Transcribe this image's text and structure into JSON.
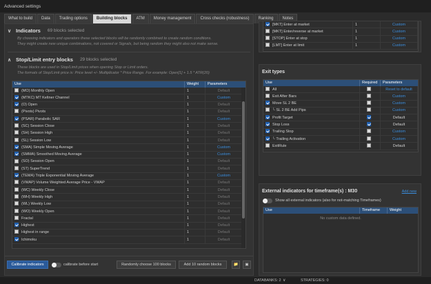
{
  "window": {
    "title": "Advanced settings"
  },
  "tabs": [
    {
      "label": "What to build"
    },
    {
      "label": "Data"
    },
    {
      "label": "Trading options"
    },
    {
      "label": "Building blocks",
      "active": true
    },
    {
      "label": "ATM"
    },
    {
      "label": "Money management"
    },
    {
      "label": "Cross checks (robustness)"
    },
    {
      "label": "Ranking"
    },
    {
      "label": "Notes"
    }
  ],
  "indicators": {
    "title": "Indicators",
    "count": "69 blocks selected",
    "desc1": "By choosing indicators and operators these selected blocks will be randomly combined to create random conditions.",
    "desc2": "They might create new unique combinations, not covered or Signals, but being random they might also not make sense."
  },
  "stoplimit": {
    "title": "Stop/Limit entry blocks",
    "count": "29 blocks selected",
    "desc1": "These blocks are used in Stop/Limit prices when opening Stop or Limit orders.",
    "desc2": "The formats of Stop/Limit price is: Price level +/- Multiplicator * Price Range. For example: Open[1] + 1.5 * ATR(20)",
    "headers": {
      "use": "Use",
      "weight": "Weight",
      "params": "Parameters"
    },
    "rows": [
      {
        "name": "(MO) Monthly Open",
        "on": false,
        "weight": "1",
        "params": "Default"
      },
      {
        "name": "(MTKC) MT Keltner Channel",
        "on": true,
        "weight": "1",
        "params": "Custom"
      },
      {
        "name": "(O) Open",
        "on": true,
        "weight": "1",
        "params": "Default"
      },
      {
        "name": "(Pivots) Pivots",
        "on": false,
        "weight": "1",
        "params": "Default"
      },
      {
        "name": "(PSAR) Parabolic SAR",
        "on": true,
        "weight": "1",
        "params": "Custom"
      },
      {
        "name": "(SC) Session Close",
        "on": false,
        "weight": "1",
        "params": "Default"
      },
      {
        "name": "(SH) Session High",
        "on": false,
        "weight": "1",
        "params": "Default"
      },
      {
        "name": "(SL) Session Low",
        "on": false,
        "weight": "1",
        "params": "Default"
      },
      {
        "name": "(SMA) Simple Moving Average",
        "on": true,
        "weight": "1",
        "params": "Custom"
      },
      {
        "name": "(SMMA) Smoothed Moving Average",
        "on": true,
        "weight": "1",
        "params": "Custom"
      },
      {
        "name": "(SO) Session Open",
        "on": false,
        "weight": "1",
        "params": "Default"
      },
      {
        "name": "(ST) SuperTrend",
        "on": false,
        "weight": "1",
        "params": "Default"
      },
      {
        "name": "(TEMA) Triple Exponential Moving Average",
        "on": true,
        "weight": "1",
        "params": "Custom"
      },
      {
        "name": "(VWAP) Volume Weighted Average Price - VWAP",
        "on": false,
        "weight": "1",
        "params": "Default"
      },
      {
        "name": "(WC) Weekly Close",
        "on": false,
        "weight": "1",
        "params": "Default"
      },
      {
        "name": "(WH) Weekly High",
        "on": false,
        "weight": "1",
        "params": "Default"
      },
      {
        "name": "(WL) Weekly Low",
        "on": false,
        "weight": "1",
        "params": "Default"
      },
      {
        "name": "(WO) Weekly Open",
        "on": false,
        "weight": "1",
        "params": "Default"
      },
      {
        "name": "Fractal",
        "on": false,
        "weight": "1",
        "params": "Default"
      },
      {
        "name": "Highest",
        "on": true,
        "weight": "1",
        "params": "Default"
      },
      {
        "name": "Highest in range",
        "on": false,
        "weight": "1",
        "params": "Default"
      },
      {
        "name": "Ichimoku",
        "on": true,
        "weight": "1",
        "params": "Default"
      }
    ]
  },
  "bottom": {
    "calibrate": "Calibrate indicators",
    "calibrate_toggle": "calibrate before start",
    "random100": "Randomly choose 100 blocks",
    "add10": "Add 10 random blocks"
  },
  "orders": {
    "rows": [
      {
        "name": "[MKT] Enter at market",
        "on": true,
        "weight": "1",
        "params": "Custom"
      },
      {
        "name": "[MKT] Enter/reverse at market",
        "on": false,
        "weight": "1",
        "params": "Custom"
      },
      {
        "name": "[STOP] Enter at stop",
        "on": false,
        "weight": "1",
        "params": "Custom"
      },
      {
        "name": "[LMT] Enter at limit",
        "on": false,
        "weight": "1",
        "params": "Custom"
      }
    ]
  },
  "exit": {
    "title": "Exit types",
    "headers": {
      "use": "Use",
      "required": "Required",
      "params": "Parameters"
    },
    "rows": [
      {
        "name": "All",
        "on": false,
        "req": false,
        "params": "Reset to default",
        "link": true
      },
      {
        "name": "Exit After Bars",
        "on": false,
        "req": false,
        "params": "Custom",
        "link": true
      },
      {
        "name": "Move SL 2 BE",
        "on": true,
        "req": false,
        "params": "Custom",
        "link": true
      },
      {
        "name": "└ SL 2 BE Add Pips",
        "on": false,
        "req": false,
        "params": "Custom",
        "link": true
      },
      {
        "name": "Profit Target",
        "on": true,
        "req": true,
        "params": "Default",
        "link": false
      },
      {
        "name": "Stop Loss",
        "on": true,
        "req": true,
        "params": "Default",
        "link": false
      },
      {
        "name": "Trailing Stop",
        "on": true,
        "req": false,
        "params": "Custom",
        "link": true
      },
      {
        "name": "└ Trailing Activation",
        "on": true,
        "req": false,
        "params": "Custom",
        "link": true
      },
      {
        "name": "ExitRule",
        "on": false,
        "req": false,
        "params": "Default",
        "link": false
      }
    ]
  },
  "external": {
    "title": "External indicators for timeframe(s) : M30",
    "add": "Add new",
    "toggle_label": "Show all external indicators (also for not-matching Timeframes)",
    "headers": {
      "use": "Use",
      "timeframe": "Timeframe",
      "weight": "Weight"
    },
    "empty": "No custom data defined."
  },
  "status": {
    "databanks": "DATABANKS: 2",
    "strategies": "STRATEGIES: 0"
  },
  "colors": {
    "accent": "#2c4f78",
    "link": "#3b8fe0",
    "check": "#1f5fb0"
  }
}
